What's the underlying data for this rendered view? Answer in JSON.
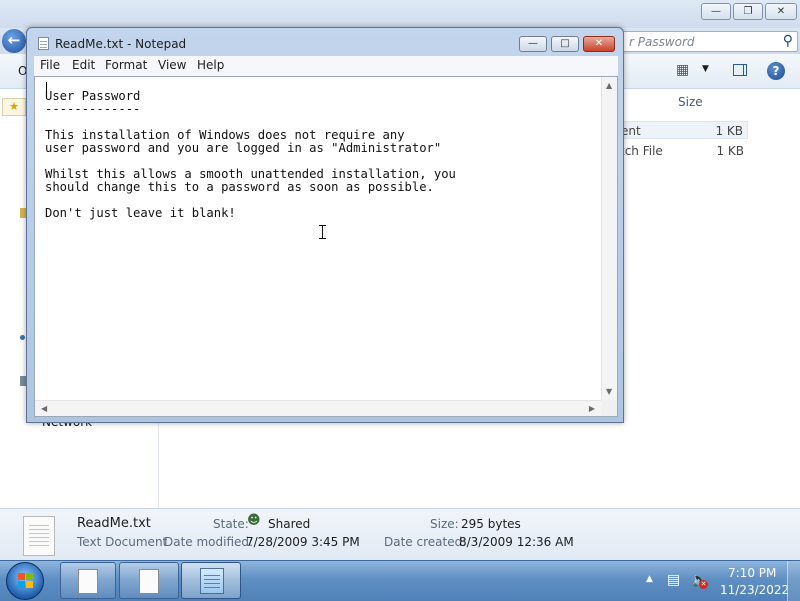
{
  "explorer": {
    "search_placeholder": "Search Password",
    "search_visible": "r Password",
    "toolbar_left": "O",
    "column_size": "Size",
    "sidebar_network": "Network",
    "files": [
      {
        "name_visible": "ent",
        "size": "1 KB"
      },
      {
        "name_visible": "tch File",
        "size": "1 KB"
      }
    ]
  },
  "details": {
    "filename": "ReadMe.txt",
    "filetype": "Text Document",
    "state_label": "State:",
    "state_value": "Shared",
    "modified_label": "Date modified:",
    "modified_value": "7/28/2009 3:45 PM",
    "size_label": "Size:",
    "size_value": "295 bytes",
    "created_label": "Date created:",
    "created_value": "8/3/2009 12:36 AM"
  },
  "notepad": {
    "title": "ReadMe.txt - Notepad",
    "menu": [
      "File",
      "Edit",
      "Format",
      "View",
      "Help"
    ],
    "lines": [
      "User Password",
      "-------------",
      "",
      "This installation of Windows does not require any",
      "user password and you are logged in as \"Administrator\"",
      "",
      "Whilst this allows a smooth unattended installation, you",
      "should change this to a password as soon as possible.",
      "",
      "Don't just leave it blank!"
    ]
  },
  "taskbar": {
    "clock_time": "7:10 PM",
    "clock_date": "11/23/2022"
  },
  "colors": {
    "accent": "#4f80b7",
    "close": "#c7432a"
  },
  "icons": {
    "back": "back-arrow-icon",
    "search": "search-icon",
    "help": "help-icon",
    "shared": "shared-users-icon",
    "network": "network-icon",
    "volume": "volume-muted-icon"
  }
}
